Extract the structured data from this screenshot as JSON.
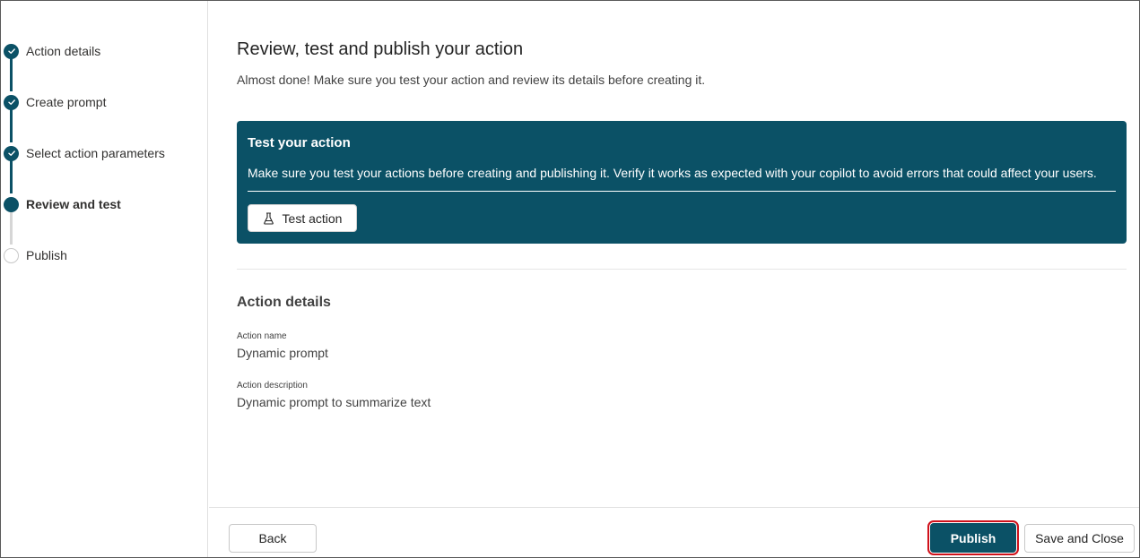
{
  "steps": [
    {
      "label": "Action details",
      "state": "done"
    },
    {
      "label": "Create prompt",
      "state": "done"
    },
    {
      "label": "Select action parameters",
      "state": "done"
    },
    {
      "label": "Review and test",
      "state": "current"
    },
    {
      "label": "Publish",
      "state": "pending"
    }
  ],
  "main": {
    "title": "Review, test and publish your action",
    "subtitle": "Almost done! Make sure you test your action and review its details before creating it.",
    "test_card": {
      "title": "Test your action",
      "text": "Make sure you test your actions before creating and publishing it. Verify it works as expected with your copilot to avoid errors that could affect your users.",
      "button_label": "Test action",
      "button_icon": "beaker-icon"
    },
    "details": {
      "heading": "Action details",
      "name_label": "Action name",
      "name_value": "Dynamic prompt",
      "description_label": "Action description",
      "description_value": "Dynamic prompt to summarize text"
    }
  },
  "footer": {
    "back_label": "Back",
    "publish_label": "Publish",
    "save_close_label": "Save and Close"
  },
  "colors": {
    "accent": "#0b5166",
    "highlight": "#d0111b"
  }
}
